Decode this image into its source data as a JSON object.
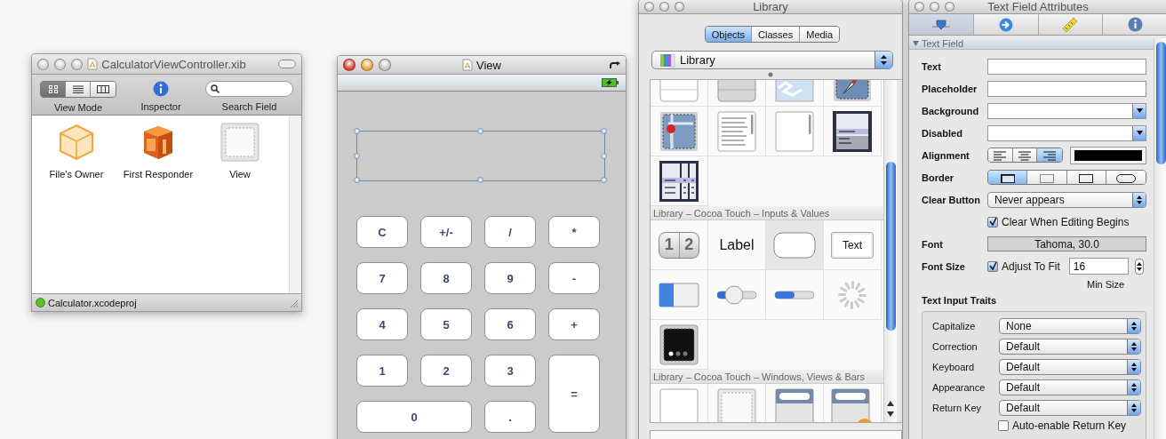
{
  "xib_window": {
    "title": "CalculatorViewController.xib",
    "active": false,
    "view_modes": [
      {
        "kind": "icons",
        "selected": true
      },
      {
        "kind": "list",
        "selected": false
      },
      {
        "kind": "columns",
        "selected": false
      }
    ],
    "toolbar_labels": {
      "view_mode": "View Mode",
      "inspector": "Inspector",
      "search": "Search Field"
    },
    "items": [
      {
        "kind": "owner",
        "label": "File's Owner"
      },
      {
        "kind": "responder",
        "label": "First Responder"
      },
      {
        "kind": "view",
        "label": "View"
      }
    ],
    "status": "Calculator.xcodeproj"
  },
  "view_window": {
    "title": "View",
    "active": true,
    "keys": [
      {
        "label": "C",
        "kind": "normal"
      },
      {
        "label": "+/-",
        "kind": "normal"
      },
      {
        "label": "/",
        "kind": "normal"
      },
      {
        "label": "*",
        "kind": "normal"
      },
      {
        "label": "7",
        "kind": "normal"
      },
      {
        "label": "8",
        "kind": "normal"
      },
      {
        "label": "9",
        "kind": "normal"
      },
      {
        "label": "-",
        "kind": "normal"
      },
      {
        "label": "4",
        "kind": "normal"
      },
      {
        "label": "5",
        "kind": "normal"
      },
      {
        "label": "6",
        "kind": "normal"
      },
      {
        "label": "+",
        "kind": "normal"
      },
      {
        "label": "1",
        "kind": "normal"
      },
      {
        "label": "2",
        "kind": "normal"
      },
      {
        "label": "3",
        "kind": "normal"
      },
      {
        "label": "=",
        "kind": "tall"
      },
      {
        "label": "0",
        "kind": "wide"
      },
      {
        "label": ".",
        "kind": "normal"
      }
    ]
  },
  "library_window": {
    "title": "Library",
    "active": false,
    "tabs": [
      {
        "label": "Objects",
        "selected": true
      },
      {
        "label": "Classes",
        "selected": false
      },
      {
        "label": "Media",
        "selected": false
      }
    ],
    "popup": "Library",
    "sections": [
      {
        "items": [
          {
            "kind": "table-plain",
            "selected": false
          },
          {
            "kind": "table-grouped",
            "selected": false
          },
          {
            "kind": "image",
            "selected": false
          },
          {
            "kind": "web",
            "selected": false
          },
          {
            "kind": "map",
            "selected": false
          },
          {
            "kind": "text-view",
            "selected": false
          },
          {
            "kind": "scroll-view",
            "selected": false
          },
          {
            "kind": "picker",
            "selected": false
          },
          {
            "kind": "date-picker",
            "selected": false
          }
        ]
      },
      {
        "title": "Library – Cocoa Touch – Inputs & Values",
        "items": [
          {
            "kind": "segmented",
            "segments": [
              "1",
              "2"
            ],
            "selected": false
          },
          {
            "kind": "label",
            "text": "Label",
            "selected": false
          },
          {
            "kind": "rounded-field",
            "selected": true
          },
          {
            "kind": "text-field",
            "text": "Text",
            "selected": false
          },
          {
            "kind": "switch",
            "selected": false
          },
          {
            "kind": "slider",
            "selected": false
          },
          {
            "kind": "progress",
            "selected": false
          },
          {
            "kind": "activity",
            "selected": false
          },
          {
            "kind": "page-control",
            "selected": false
          }
        ]
      },
      {
        "title": "Library – Cocoa Touch – Windows, Views & Bars",
        "items": [
          {
            "kind": "view",
            "selected": false
          },
          {
            "kind": "container",
            "selected": false
          },
          {
            "kind": "search-bar",
            "selected": false
          },
          {
            "kind": "search-display",
            "selected": false
          }
        ]
      }
    ]
  },
  "inspector_window": {
    "title": "Text Field Attributes",
    "active": false,
    "tabs": [
      {
        "kind": "attributes",
        "selected": true
      },
      {
        "kind": "connections",
        "selected": false
      },
      {
        "kind": "size",
        "selected": false
      },
      {
        "kind": "identity",
        "selected": false
      }
    ],
    "section": "Text Field",
    "rows": [
      {
        "kind": "input",
        "label": "Text"
      },
      {
        "kind": "input",
        "label": "Placeholder"
      },
      {
        "kind": "color",
        "label": "Background"
      },
      {
        "kind": "color",
        "label": "Disabled"
      },
      {
        "kind": "alignment",
        "label": "Alignment",
        "color": "#000000",
        "options": [
          {
            "kind": "left",
            "selected": false
          },
          {
            "kind": "center",
            "selected": false
          },
          {
            "kind": "right",
            "selected": true
          }
        ]
      },
      {
        "kind": "border",
        "label": "Border",
        "options": [
          {
            "kind": "bezel",
            "selected": true
          },
          {
            "kind": "dotted",
            "selected": false
          },
          {
            "kind": "line",
            "selected": false
          },
          {
            "kind": "rounded",
            "selected": false
          }
        ]
      },
      {
        "kind": "popup",
        "label": "Clear Button",
        "value": "Never appears"
      },
      {
        "kind": "checkbox",
        "label": "Clear When Editing Begins",
        "checked": true
      },
      {
        "kind": "font",
        "label": "Font",
        "value": "Tahoma, 30.0"
      },
      {
        "kind": "font-size",
        "label": "Font Size",
        "check_label": "Adjust To Fit",
        "checked": true,
        "value": "16",
        "caption": "Min Size"
      }
    ],
    "traits_title": "Text Input Traits",
    "traits": [
      {
        "label": "Capitalize",
        "value": "None"
      },
      {
        "label": "Correction",
        "value": "Default"
      },
      {
        "label": "Keyboard",
        "value": "Default"
      },
      {
        "label": "Appearance",
        "value": "Default"
      },
      {
        "label": "Return Key",
        "value": "Default"
      }
    ],
    "traits_checkbox": {
      "label": "Auto-enable Return Key",
      "checked": false
    }
  }
}
